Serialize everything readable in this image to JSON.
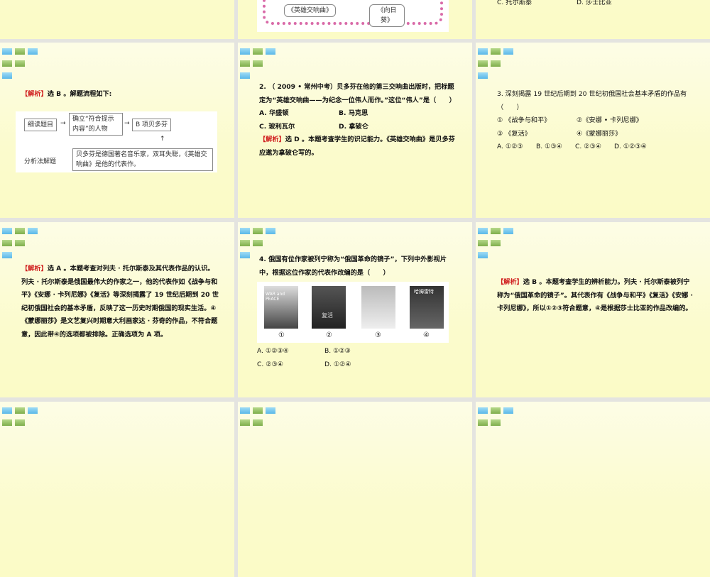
{
  "slides": [
    {
      "figure": {
        "labels": [
          "《英雄交响曲》",
          "《向日葵》"
        ]
      }
    },
    {
      "options": [
        "C. 托尔斯泰",
        "D. 莎士比亚"
      ]
    },
    {
      "tag": "【解析】",
      "text": "选 B 。解题流程如下:",
      "flow": {
        "step1": "细读题目",
        "step2": "确立“符合提示内容”的人物",
        "step3": "B 项贝多芬",
        "left": "分析法解题",
        "note": "贝多芬是德国著名音乐家，双耳失聪，《英雄交响曲》是他的代表作。"
      }
    },
    {
      "question": "2. （ 2009 • 常州中考）贝多芬在他的第三交响曲出版时，把标题定为“英雄交响曲——为纪念一位伟人而作。”这位“伟人”是（　　）",
      "options": [
        "A. 华盛顿",
        "B. 马克思",
        "C. 玻利瓦尔",
        "D. 拿破仑"
      ],
      "tag": "【解析】",
      "text": "选 D 。本题考查学生的识记能力。《英雄交响曲》是贝多芬应邀为拿破仑写的。"
    },
    {
      "question": "3. 深刻揭露 19 世纪后期到 20 世纪初俄国社会基本矛盾的作品有（　　）",
      "items": [
        "① 《战争与和平》",
        "②《安娜 • 卡列尼娜》",
        "③ 《复活》",
        "④《蒙娜丽莎》"
      ],
      "options": [
        "A. ①②③",
        "B. ①③④",
        "C. ②③④",
        "D. ①②③④"
      ]
    },
    {
      "tag": "【解析】",
      "text": "选 A 。本题考查对列夫 · 托尔斯泰及其代表作品的认识。列夫 · 托尔斯泰是俄国最伟大的作家之一，他的代表作如《战争与和平》《安娜 · 卡列尼娜》《复活》等深刻揭露了 19 世纪后期到 20 世纪初俄国社会的基本矛盾，反映了这一历史时期俄国的现实生活。④《蒙娜丽莎》是文艺复兴时期意大利画家达 · 芬奇的作品，不符合题意，因此带④的选项都被排除。正确选项为 A 项。"
    },
    {
      "question": "4. 俄国有位作家被列宁称为“俄国革命的镜子”，下列中外影视片中，根据这位作家的代表作改编的是（　　）",
      "posters": [
        "①",
        "②",
        "③",
        "④"
      ],
      "poster_titles": [
        "WAR and PEACE",
        "复活",
        "",
        "哈姆雷特"
      ],
      "options": [
        "A. ①②③④",
        "B. ①②③",
        "C. ②③④",
        "D. ①②④"
      ]
    },
    {
      "tag": "【解析】",
      "text": "选 B 。本题考查学生的辨析能力。列夫 · 托尔斯泰被列宁称为“俄国革命的镜子”。其代表作有《战争与和平》《复活》《安娜 · 卡列尼娜》，所以①②③符合题意，④是根据莎士比亚的作品改编的。"
    }
  ]
}
